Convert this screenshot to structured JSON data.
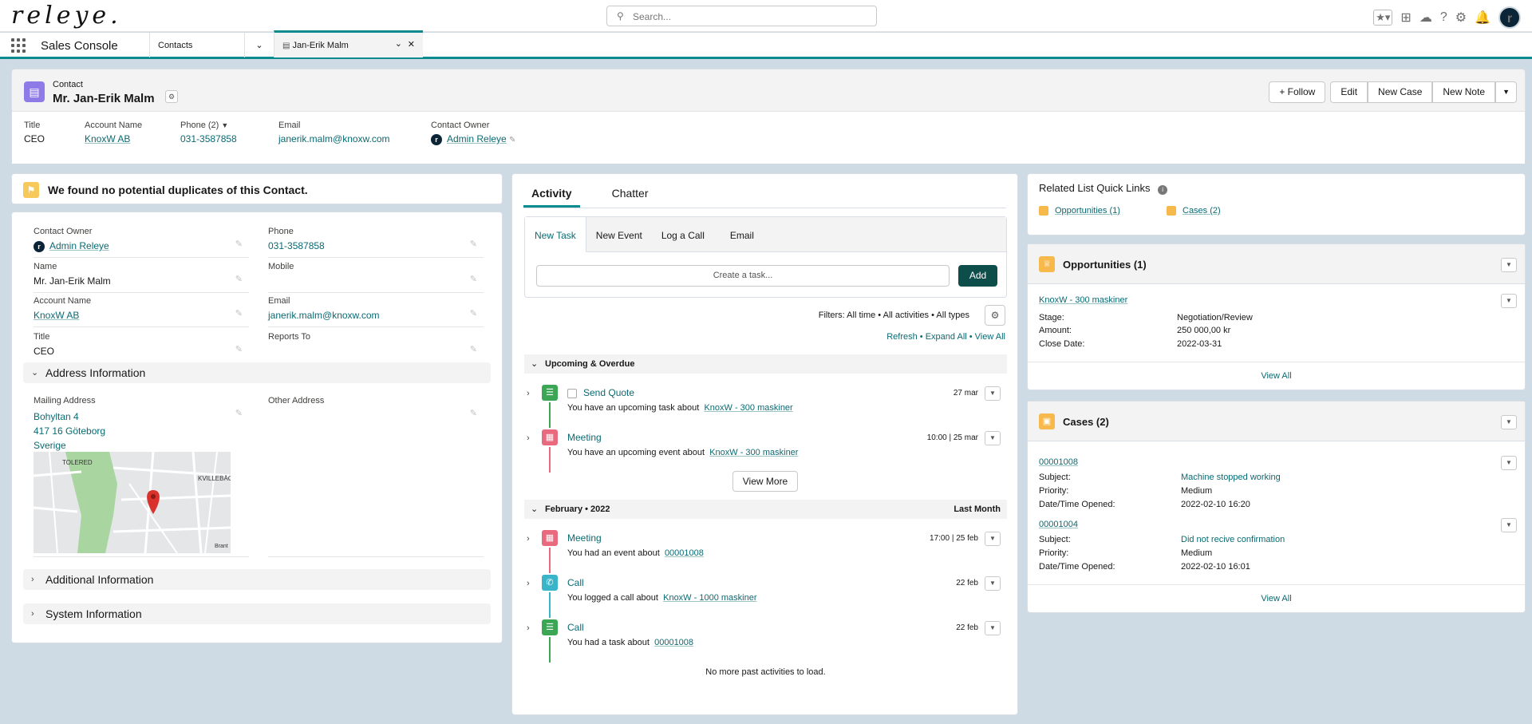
{
  "topbar": {
    "logo": "releye.",
    "search_placeholder": "Search...",
    "avatar_letter": "r"
  },
  "nav": {
    "app_name": "Sales Console",
    "tab_contacts": "Contacts",
    "tab_record": "Jan-Erik Malm"
  },
  "header": {
    "type": "Contact",
    "name": "Mr. Jan-Erik Malm",
    "buttons": {
      "follow": "Follow",
      "edit": "Edit",
      "new_case": "New Case",
      "new_note": "New Note"
    },
    "fields": {
      "title_label": "Title",
      "title_value": "CEO",
      "account_label": "Account Name",
      "account_value": "KnoxW AB",
      "phone_label": "Phone (2)",
      "phone_value": "031-3587858",
      "email_label": "Email",
      "email_value": "janerik.malm@knoxw.com",
      "owner_label": "Contact Owner",
      "owner_value": "Admin Releye"
    }
  },
  "duplicates": {
    "message": "We found no potential duplicates of this Contact."
  },
  "details": {
    "contact_owner_label": "Contact Owner",
    "contact_owner": "Admin Releye",
    "phone_label": "Phone",
    "phone": "031-3587858",
    "name_label": "Name",
    "name": "Mr. Jan-Erik Malm",
    "mobile_label": "Mobile",
    "mobile": "",
    "account_label": "Account Name",
    "account": "KnoxW AB",
    "email_label": "Email",
    "email": "janerik.malm@knoxw.com",
    "title_label": "Title",
    "title": "CEO",
    "reports_label": "Reports To",
    "reports": "",
    "address_section": "Address Information",
    "mailing_label": "Mailing Address",
    "mailing_line1": "Bohyltan 4",
    "mailing_line2": "417 16 Göteborg",
    "mailing_line3": "Sverige",
    "other_address_label": "Other Address",
    "map_labels": {
      "a": "TOLERED",
      "b": "KVILLEBÄC",
      "c": "Brant"
    },
    "additional_section": "Additional Information",
    "system_section": "System Information"
  },
  "activity": {
    "tab_activity": "Activity",
    "tab_chatter": "Chatter",
    "subtabs": [
      "New Task",
      "New Event",
      "Log a Call",
      "Email"
    ],
    "create_placeholder": "Create a task...",
    "add_label": "Add",
    "filters": "Filters: All time • All activities • All types",
    "refresh": "Refresh",
    "expand_all": "Expand All",
    "view_all": "View All",
    "group1": "Upcoming & Overdue",
    "item1": {
      "title": "Send Quote",
      "text": "You have an upcoming task about",
      "link": "KnoxW - 300 maskiner",
      "date": "27 mar"
    },
    "item2": {
      "title": "Meeting",
      "text": "You have an upcoming event about",
      "link": "KnoxW - 300 maskiner",
      "date": "10:00 | 25 mar"
    },
    "view_more": "View More",
    "group2": "February • 2022",
    "group2_right": "Last Month",
    "item3": {
      "title": "Meeting",
      "text": "You had an event about",
      "link": "00001008",
      "date": "17:00 | 25 feb"
    },
    "item4": {
      "title": "Call",
      "text": "You logged a call about",
      "link": "KnoxW - 1000 maskiner",
      "date": "22 feb"
    },
    "item5": {
      "title": "Call",
      "text": "You had a task about",
      "link": "00001008",
      "date": "22 feb"
    },
    "no_more": "No more past activities to load."
  },
  "quick_links": {
    "title": "Related List Quick Links",
    "opps": "Opportunities (1)",
    "cases": "Cases (2)"
  },
  "opportunities": {
    "title": "Opportunities (1)",
    "record": "KnoxW - 300 maskiner",
    "stage_label": "Stage:",
    "stage": "Negotiation/Review",
    "amount_label": "Amount:",
    "amount": "250 000,00 kr",
    "close_label": "Close Date:",
    "close": "2022-03-31",
    "view_all": "View All"
  },
  "cases": {
    "title": "Cases (2)",
    "c1": {
      "number": "00001008",
      "subject_label": "Subject:",
      "subject": "Machine stopped working",
      "priority_label": "Priority:",
      "priority": "Medium",
      "opened_label": "Date/Time Opened:",
      "opened": "2022-02-10 16:20"
    },
    "c2": {
      "number": "00001004",
      "subject_label": "Subject:",
      "subject": "Did not recive confirmation",
      "priority_label": "Priority:",
      "priority": "Medium",
      "opened_label": "Date/Time Opened:",
      "opened": "2022-02-10 16:01"
    },
    "view_all": "View All"
  }
}
